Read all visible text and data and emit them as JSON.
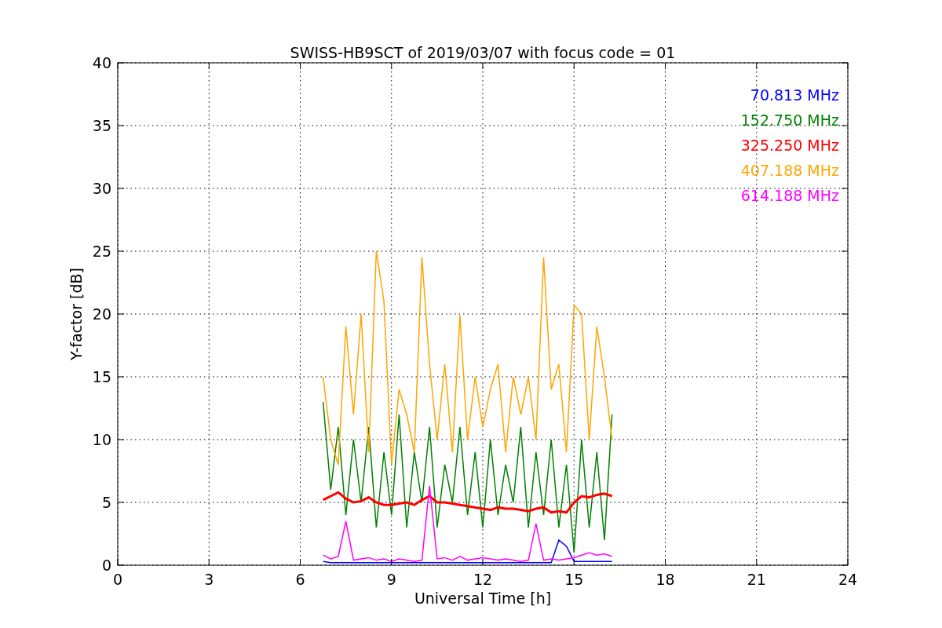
{
  "chart_data": {
    "type": "line",
    "title": "SWISS-HB9SCT of 2019/03/07 with focus code = 01",
    "xlabel": "Universal Time [h]",
    "ylabel": "Y-factor [dB]",
    "x": [
      6.75,
      7,
      7.25,
      7.5,
      7.75,
      8,
      8.25,
      8.5,
      8.75,
      9,
      9.25,
      9.5,
      9.75,
      10,
      10.25,
      10.5,
      10.75,
      11,
      11.25,
      11.5,
      11.75,
      12,
      12.25,
      12.5,
      12.75,
      13,
      13.25,
      13.5,
      13.75,
      14,
      14.25,
      14.5,
      14.75,
      15,
      15.25,
      15.5,
      15.75,
      16,
      16.25
    ],
    "series": [
      {
        "name": "70.813 MHz",
        "color": "#0000ff",
        "values": [
          0.3,
          0.2,
          0.2,
          0.2,
          0.2,
          0.2,
          0.2,
          0.2,
          0.2,
          0.2,
          0.2,
          0.2,
          0.2,
          0.2,
          0.2,
          0.2,
          0.2,
          0.2,
          0.2,
          0.2,
          0.2,
          0.2,
          0.2,
          0.2,
          0.2,
          0.2,
          0.2,
          0.2,
          0.2,
          0.2,
          0.2,
          2.0,
          1.5,
          0.3,
          0.3,
          0.3,
          0.3,
          0.3,
          0.3
        ]
      },
      {
        "name": "152.750 MHz",
        "color": "#008000",
        "values": [
          13,
          6,
          11,
          4,
          10,
          5,
          11,
          3,
          9,
          4,
          12,
          3,
          9,
          5,
          11,
          3,
          8,
          5,
          11,
          4,
          9,
          3,
          10,
          4,
          8,
          5,
          11,
          3,
          9,
          4,
          10,
          3,
          8,
          1,
          10,
          3,
          9,
          2,
          12
        ]
      },
      {
        "name": "325.250 MHz",
        "color": "#ff0000",
        "values": [
          5.2,
          5.5,
          5.8,
          5.3,
          5.0,
          5.1,
          5.4,
          5.0,
          4.8,
          4.8,
          4.9,
          5.0,
          4.8,
          5.2,
          5.5,
          5.0,
          5.0,
          4.9,
          4.8,
          4.7,
          4.6,
          4.5,
          4.4,
          4.6,
          4.5,
          4.5,
          4.4,
          4.3,
          4.5,
          4.6,
          4.2,
          4.3,
          4.2,
          5.0,
          5.5,
          5.4,
          5.6,
          5.7,
          5.5
        ]
      },
      {
        "name": "407.188 MHz",
        "color": "#ffa500",
        "values": [
          15,
          10,
          8,
          19,
          12,
          20,
          9,
          25,
          21,
          8,
          14,
          12,
          9,
          24.5,
          16,
          10,
          16,
          9,
          19.9,
          10,
          15,
          11,
          14,
          16,
          9,
          15,
          12,
          15,
          10,
          24.5,
          14,
          16,
          9,
          20.7,
          20,
          10,
          19,
          15,
          10
        ]
      },
      {
        "name": "614.188 MHz",
        "color": "#ff00ff",
        "values": [
          0.8,
          0.5,
          0.7,
          3.5,
          0.4,
          0.5,
          0.6,
          0.4,
          0.5,
          0.3,
          0.5,
          0.4,
          0.3,
          0.4,
          6.3,
          0.5,
          0.6,
          0.4,
          0.7,
          0.4,
          0.5,
          0.6,
          0.5,
          0.4,
          0.5,
          0.4,
          0.3,
          0.4,
          3.3,
          0.4,
          0.5,
          0.4,
          0.5,
          0.6,
          0.8,
          1.0,
          0.8,
          0.9,
          0.7
        ]
      }
    ],
    "xlim": [
      0,
      24
    ],
    "ylim": [
      0,
      40
    ],
    "xticks": [
      0,
      3,
      6,
      9,
      12,
      15,
      18,
      21,
      24
    ],
    "yticks": [
      0,
      5,
      10,
      15,
      20,
      25,
      30,
      35,
      40
    ],
    "grid": true
  }
}
